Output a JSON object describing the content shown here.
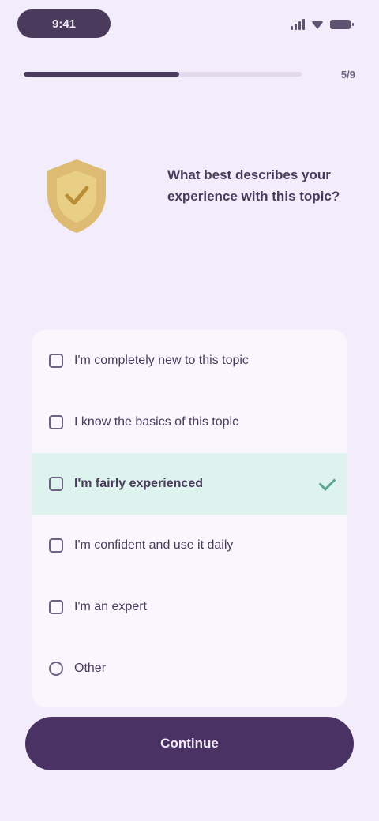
{
  "status_bar": {
    "time": "9:41"
  },
  "progress": {
    "fraction": 0.56,
    "label": "5/9"
  },
  "hero": {
    "text": "What best describes your experience with this topic?"
  },
  "options": [
    {
      "label": "I'm completely new to this topic",
      "selected": false
    },
    {
      "label": "I know the basics of this topic",
      "selected": false
    },
    {
      "label": "I'm fairly experienced",
      "selected": true
    },
    {
      "label": "I'm confident and use it daily",
      "selected": false
    },
    {
      "label": "I'm an expert",
      "selected": false
    },
    {
      "label": "Other",
      "selected": false
    }
  ],
  "continue_button": {
    "label": "Continue"
  },
  "colors": {
    "background": "#f3ecfa",
    "primary": "#4a3364",
    "selected_row": "#dff3ee",
    "check": "#5aa893",
    "badge": "#d9b35a"
  }
}
